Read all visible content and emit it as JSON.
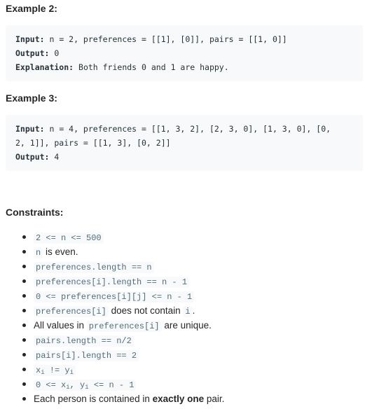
{
  "example2": {
    "heading": "Example 2:",
    "lines": [
      {
        "label": "Input:",
        "text": " n = 2, preferences = [[1], [0]], pairs = [[1, 0]]"
      },
      {
        "label": "Output:",
        "text": " 0"
      },
      {
        "label": "Explanation:",
        "text": " Both friends 0 and 1 are happy."
      }
    ]
  },
  "example3": {
    "heading": "Example 3:",
    "lines": [
      {
        "label": "Input:",
        "text": " n = 4, preferences = [[1, 3, 2], [2, 3, 0], [1, 3, 0], [0,"
      },
      {
        "label": "",
        "text": "2, 1]], pairs = [[1, 3], [0, 2]]"
      },
      {
        "label": "Output:",
        "text": " 4"
      }
    ]
  },
  "constraints": {
    "heading": "Constraints:",
    "items": [
      [
        {
          "k": "code",
          "parts": [
            {
              "t": "2 <= n <= 500"
            }
          ]
        }
      ],
      [
        {
          "k": "code",
          "parts": [
            {
              "t": "n"
            }
          ]
        },
        {
          "k": "text",
          "t": " is even."
        }
      ],
      [
        {
          "k": "code",
          "parts": [
            {
              "t": "preferences.length  == n"
            }
          ]
        }
      ],
      [
        {
          "k": "code",
          "parts": [
            {
              "t": "preferences[i].length  == n - 1"
            }
          ]
        }
      ],
      [
        {
          "k": "code",
          "parts": [
            {
              "t": "0 <= preferences[i][j] <= n - 1"
            }
          ]
        }
      ],
      [
        {
          "k": "code",
          "parts": [
            {
              "t": "preferences[i]"
            }
          ]
        },
        {
          "k": "text",
          "t": " does not contain "
        },
        {
          "k": "code",
          "parts": [
            {
              "t": "i"
            }
          ]
        },
        {
          "k": "text",
          "t": "."
        }
      ],
      [
        {
          "k": "text",
          "t": "All values in "
        },
        {
          "k": "code",
          "parts": [
            {
              "t": "preferences[i]"
            }
          ]
        },
        {
          "k": "text",
          "t": " are unique."
        }
      ],
      [
        {
          "k": "code",
          "parts": [
            {
              "t": "pairs.length  == n/2"
            }
          ]
        }
      ],
      [
        {
          "k": "code",
          "parts": [
            {
              "t": "pairs[i].length  == 2"
            }
          ]
        }
      ],
      [
        {
          "k": "code",
          "parts": [
            {
              "t": "x"
            },
            {
              "sub": "i"
            },
            {
              "t": " != y"
            },
            {
              "sub": "i"
            }
          ]
        }
      ],
      [
        {
          "k": "code",
          "parts": [
            {
              "t": "0 <= x"
            },
            {
              "sub": "i"
            },
            {
              "t": ", y"
            },
            {
              "sub": "i"
            },
            {
              "t": "  <= n - 1"
            }
          ]
        }
      ],
      [
        {
          "k": "text",
          "t": "Each person is contained in "
        },
        {
          "k": "bold",
          "t": "exactly one"
        },
        {
          "k": "text",
          "t": " pair."
        }
      ]
    ]
  }
}
